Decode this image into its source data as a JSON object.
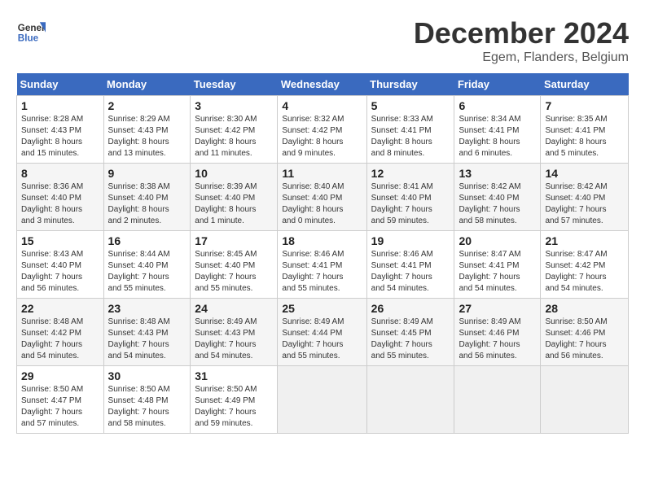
{
  "header": {
    "logo_line1": "General",
    "logo_line2": "Blue",
    "title": "December 2024",
    "subtitle": "Egem, Flanders, Belgium"
  },
  "days_of_week": [
    "Sunday",
    "Monday",
    "Tuesday",
    "Wednesday",
    "Thursday",
    "Friday",
    "Saturday"
  ],
  "weeks": [
    [
      {
        "num": "1",
        "info": "Sunrise: 8:28 AM\nSunset: 4:43 PM\nDaylight: 8 hours\nand 15 minutes."
      },
      {
        "num": "2",
        "info": "Sunrise: 8:29 AM\nSunset: 4:43 PM\nDaylight: 8 hours\nand 13 minutes."
      },
      {
        "num": "3",
        "info": "Sunrise: 8:30 AM\nSunset: 4:42 PM\nDaylight: 8 hours\nand 11 minutes."
      },
      {
        "num": "4",
        "info": "Sunrise: 8:32 AM\nSunset: 4:42 PM\nDaylight: 8 hours\nand 9 minutes."
      },
      {
        "num": "5",
        "info": "Sunrise: 8:33 AM\nSunset: 4:41 PM\nDaylight: 8 hours\nand 8 minutes."
      },
      {
        "num": "6",
        "info": "Sunrise: 8:34 AM\nSunset: 4:41 PM\nDaylight: 8 hours\nand 6 minutes."
      },
      {
        "num": "7",
        "info": "Sunrise: 8:35 AM\nSunset: 4:41 PM\nDaylight: 8 hours\nand 5 minutes."
      }
    ],
    [
      {
        "num": "8",
        "info": "Sunrise: 8:36 AM\nSunset: 4:40 PM\nDaylight: 8 hours\nand 3 minutes."
      },
      {
        "num": "9",
        "info": "Sunrise: 8:38 AM\nSunset: 4:40 PM\nDaylight: 8 hours\nand 2 minutes."
      },
      {
        "num": "10",
        "info": "Sunrise: 8:39 AM\nSunset: 4:40 PM\nDaylight: 8 hours\nand 1 minute."
      },
      {
        "num": "11",
        "info": "Sunrise: 8:40 AM\nSunset: 4:40 PM\nDaylight: 8 hours\nand 0 minutes."
      },
      {
        "num": "12",
        "info": "Sunrise: 8:41 AM\nSunset: 4:40 PM\nDaylight: 7 hours\nand 59 minutes."
      },
      {
        "num": "13",
        "info": "Sunrise: 8:42 AM\nSunset: 4:40 PM\nDaylight: 7 hours\nand 58 minutes."
      },
      {
        "num": "14",
        "info": "Sunrise: 8:42 AM\nSunset: 4:40 PM\nDaylight: 7 hours\nand 57 minutes."
      }
    ],
    [
      {
        "num": "15",
        "info": "Sunrise: 8:43 AM\nSunset: 4:40 PM\nDaylight: 7 hours\nand 56 minutes."
      },
      {
        "num": "16",
        "info": "Sunrise: 8:44 AM\nSunset: 4:40 PM\nDaylight: 7 hours\nand 55 minutes."
      },
      {
        "num": "17",
        "info": "Sunrise: 8:45 AM\nSunset: 4:40 PM\nDaylight: 7 hours\nand 55 minutes."
      },
      {
        "num": "18",
        "info": "Sunrise: 8:46 AM\nSunset: 4:41 PM\nDaylight: 7 hours\nand 55 minutes."
      },
      {
        "num": "19",
        "info": "Sunrise: 8:46 AM\nSunset: 4:41 PM\nDaylight: 7 hours\nand 54 minutes."
      },
      {
        "num": "20",
        "info": "Sunrise: 8:47 AM\nSunset: 4:41 PM\nDaylight: 7 hours\nand 54 minutes."
      },
      {
        "num": "21",
        "info": "Sunrise: 8:47 AM\nSunset: 4:42 PM\nDaylight: 7 hours\nand 54 minutes."
      }
    ],
    [
      {
        "num": "22",
        "info": "Sunrise: 8:48 AM\nSunset: 4:42 PM\nDaylight: 7 hours\nand 54 minutes."
      },
      {
        "num": "23",
        "info": "Sunrise: 8:48 AM\nSunset: 4:43 PM\nDaylight: 7 hours\nand 54 minutes."
      },
      {
        "num": "24",
        "info": "Sunrise: 8:49 AM\nSunset: 4:43 PM\nDaylight: 7 hours\nand 54 minutes."
      },
      {
        "num": "25",
        "info": "Sunrise: 8:49 AM\nSunset: 4:44 PM\nDaylight: 7 hours\nand 55 minutes."
      },
      {
        "num": "26",
        "info": "Sunrise: 8:49 AM\nSunset: 4:45 PM\nDaylight: 7 hours\nand 55 minutes."
      },
      {
        "num": "27",
        "info": "Sunrise: 8:49 AM\nSunset: 4:46 PM\nDaylight: 7 hours\nand 56 minutes."
      },
      {
        "num": "28",
        "info": "Sunrise: 8:50 AM\nSunset: 4:46 PM\nDaylight: 7 hours\nand 56 minutes."
      }
    ],
    [
      {
        "num": "29",
        "info": "Sunrise: 8:50 AM\nSunset: 4:47 PM\nDaylight: 7 hours\nand 57 minutes."
      },
      {
        "num": "30",
        "info": "Sunrise: 8:50 AM\nSunset: 4:48 PM\nDaylight: 7 hours\nand 58 minutes."
      },
      {
        "num": "31",
        "info": "Sunrise: 8:50 AM\nSunset: 4:49 PM\nDaylight: 7 hours\nand 59 minutes."
      },
      null,
      null,
      null,
      null
    ]
  ]
}
